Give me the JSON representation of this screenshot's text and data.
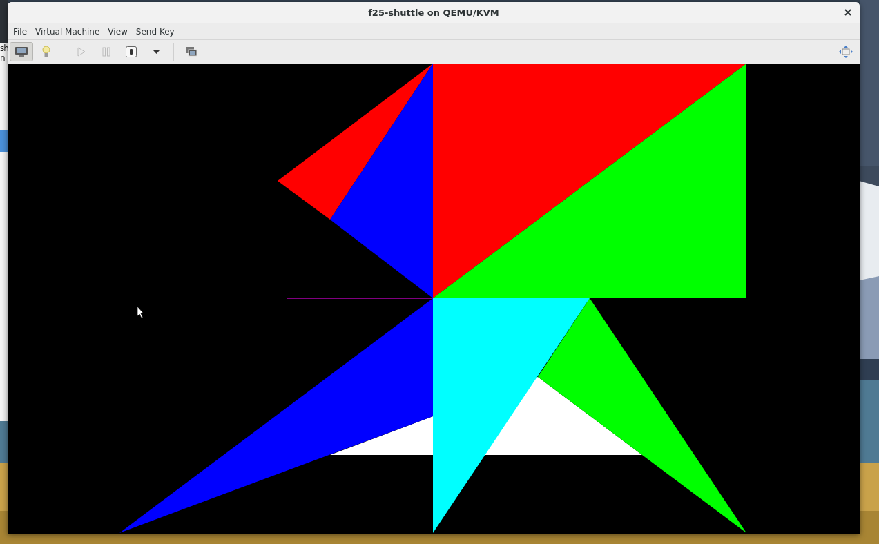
{
  "background_window": {
    "texts": [
      "sh",
      "n"
    ]
  },
  "window": {
    "title": "f25-shuttle on QEMU/KVM"
  },
  "menu": [
    "File",
    "Virtual Machine",
    "View",
    "Send Key"
  ],
  "toolbar": [
    {
      "kind": "console",
      "selected": true,
      "disabled": false
    },
    {
      "kind": "details",
      "selected": false,
      "disabled": false
    },
    {
      "kind": "separator"
    },
    {
      "kind": "run",
      "selected": false,
      "disabled": true
    },
    {
      "kind": "pause",
      "selected": false,
      "disabled": true
    },
    {
      "kind": "shutdown",
      "selected": false,
      "disabled": false
    },
    {
      "kind": "dropdown",
      "selected": false,
      "disabled": false
    },
    {
      "kind": "separator"
    },
    {
      "kind": "snapshots",
      "selected": false,
      "disabled": false
    }
  ],
  "fullscreen_button": {
    "disabled": false
  },
  "display": {
    "kind": "guest-graphics"
  }
}
